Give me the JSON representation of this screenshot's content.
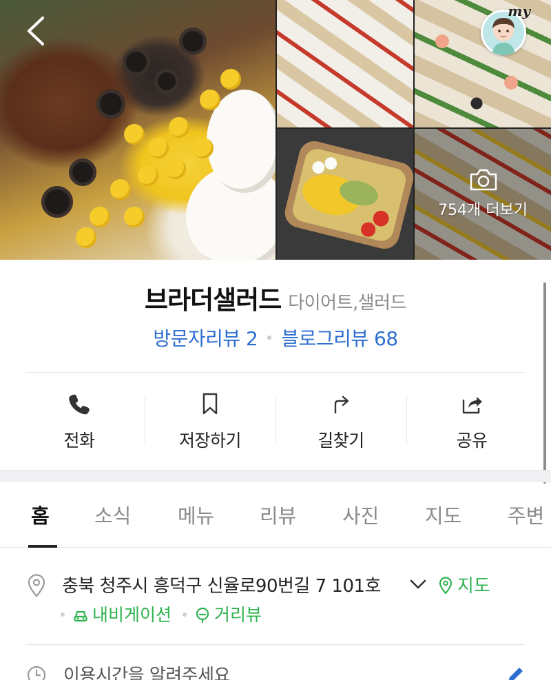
{
  "gallery": {
    "more_label": "754개 더보기",
    "my_badge": "my",
    "icons": {
      "back": "chevron-left-icon",
      "camera": "camera-icon",
      "profile": "profile-avatar-icon"
    }
  },
  "place": {
    "name": "브라더샐러드",
    "category": "다이어트,샐러드",
    "visitor_review_label": "방문자리뷰 2",
    "blog_review_label": "블로그리뷰 68"
  },
  "actions": [
    {
      "label": "전화",
      "icon": "phone-icon"
    },
    {
      "label": "저장하기",
      "icon": "bookmark-icon"
    },
    {
      "label": "길찾기",
      "icon": "directions-icon"
    },
    {
      "label": "공유",
      "icon": "share-icon"
    }
  ],
  "tabs": [
    {
      "label": "홈",
      "active": true
    },
    {
      "label": "소식",
      "active": false
    },
    {
      "label": "메뉴",
      "active": false
    },
    {
      "label": "리뷰",
      "active": false
    },
    {
      "label": "사진",
      "active": false
    },
    {
      "label": "지도",
      "active": false
    },
    {
      "label": "주변",
      "active": false
    }
  ],
  "details": {
    "address": "충북 청주시 흥덕구 신율로90번길 7 101호",
    "map_label": "지도",
    "navigation_label": "내비게이션",
    "streetview_label": "거리뷰",
    "hours_prompt": "이용시간을 알려주세요"
  },
  "colors": {
    "link_blue": "#2d6ed0",
    "naver_green": "#2fb34f",
    "muted_gray": "#8a8a8a"
  }
}
